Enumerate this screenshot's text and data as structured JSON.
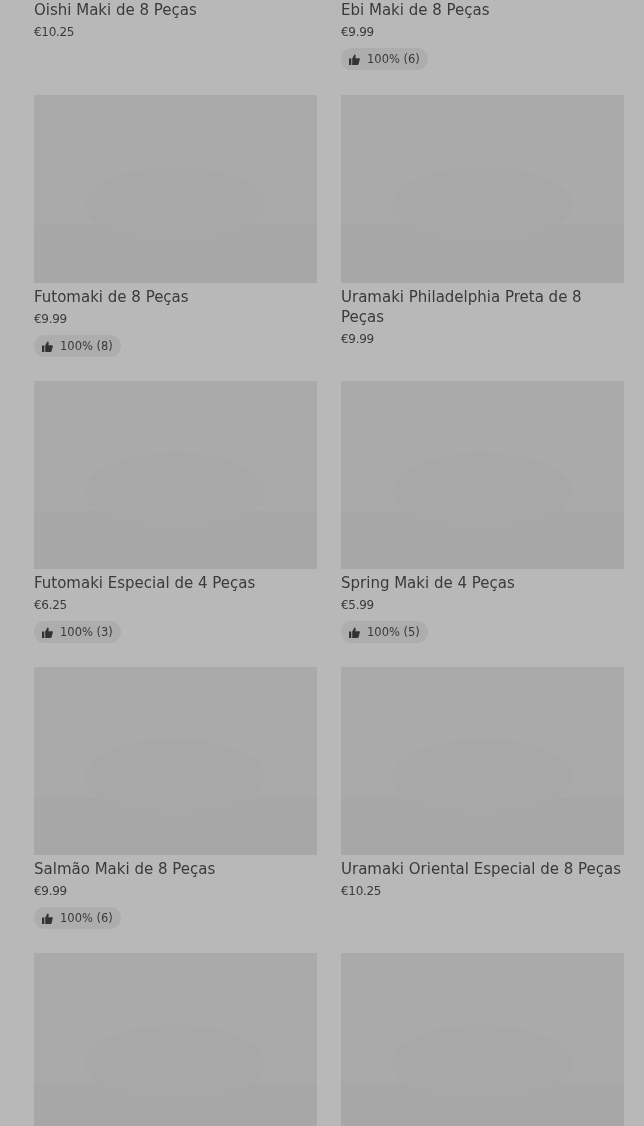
{
  "products": [
    {
      "title": "Oishi Maki de 8 Peças",
      "price": "€10.25"
    },
    {
      "title": "Ebi Maki de 8 Peças",
      "price": "€9.99",
      "rating": "100% (6)"
    },
    {
      "kind": "picture",
      "title": "Futomaki de 8 Peças",
      "price": "€9.99",
      "rating": "100% (8)"
    },
    {
      "kind": "picture",
      "title": "Uramaki Philadelphia Preta de 8 Peças",
      "price": "€9.99"
    },
    {
      "kind": "picture",
      "title": "Futomaki Especial de 4 Peças",
      "price": "€6.25",
      "rating": "100% (3)"
    },
    {
      "kind": "picture",
      "title": "Spring Maki de 4 Peças",
      "price": "€5.99",
      "rating": "100% (5)"
    },
    {
      "kind": "picture",
      "title": "Salmão Maki de 8 Peças",
      "price": "€9.99",
      "rating": "100% (6)"
    },
    {
      "kind": "picture",
      "title": "Uramaki Oriental Especial de 8 Peças",
      "price": "€10.25"
    },
    {
      "kind": "picture"
    },
    {
      "kind": "picture"
    }
  ]
}
